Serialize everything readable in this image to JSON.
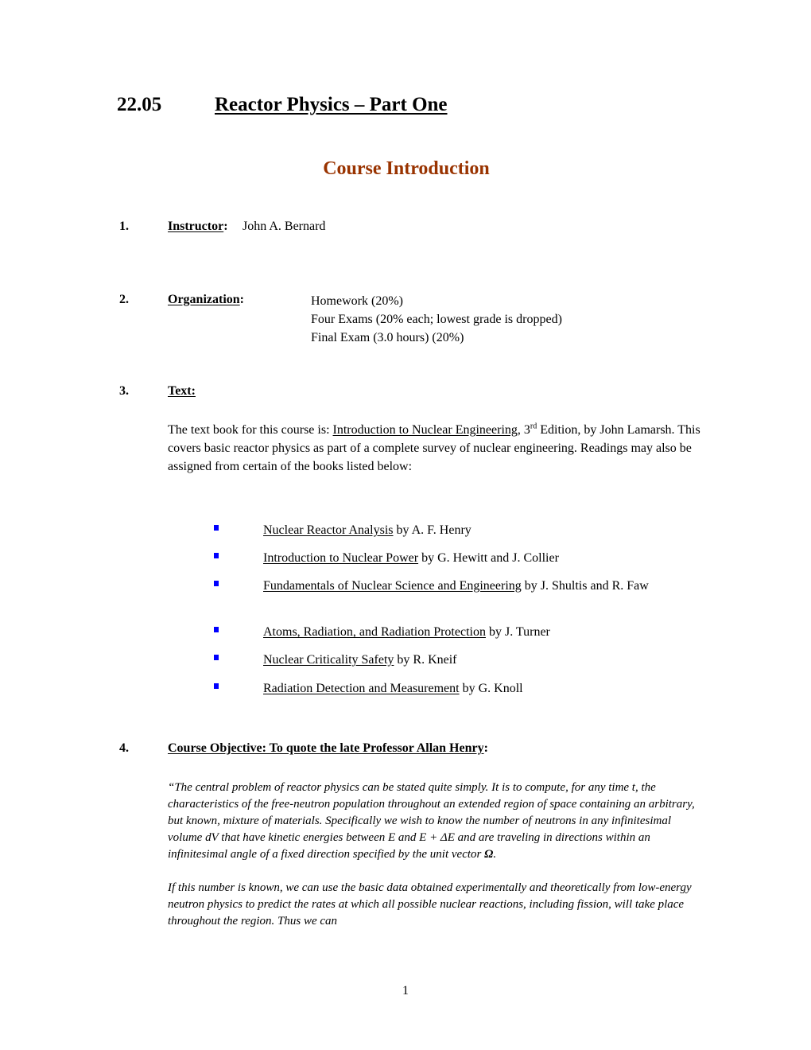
{
  "header": {
    "course_number": "22.05",
    "course_title": "Reactor Physics – Part One",
    "subtitle": "Course Introduction"
  },
  "colors": {
    "subtitle": "#993300",
    "bullet": "#0000ff"
  },
  "sections": {
    "instructor": {
      "number": "1.",
      "label": "Instructor",
      "colon": ":",
      "value": "John A. Bernard"
    },
    "organization": {
      "number": "2.",
      "label": "Organization",
      "colon": ":",
      "items": [
        "Homework  (20%)",
        "Four Exams (20% each; lowest grade is dropped)",
        "Final  Exam (3.0 hours)  (20%)"
      ]
    },
    "text": {
      "number": "3.",
      "label": "Text:",
      "intro_before": "The text book for this course is:  ",
      "textbook_title": "Introduction to Nuclear Engineering",
      "edition_num": ", 3",
      "edition_sup": "rd",
      "intro_after": " Edition, by John Lamarsh.  This covers basic reactor physics as part of a complete survey of nuclear engineering.  Readings may also be assigned from certain of the books listed below:",
      "books": [
        {
          "title": "Nuclear Reactor Analysis",
          "author": " by A. F. Henry"
        },
        {
          "title": "Introduction to Nuclear Power",
          "author": " by G. Hewitt and J. Collier"
        },
        {
          "title": "Fundamentals of Nuclear Science and Engineering",
          "author": " by J. Shultis and R. Faw"
        },
        {
          "title": "Atoms, Radiation, and Radiation Protection",
          "author": " by J. Turner"
        },
        {
          "title": "Nuclear Criticality Safety",
          "author": " by R. Kneif"
        },
        {
          "title": "Radiation Detection and Measurement",
          "author": " by G. Knoll"
        }
      ]
    },
    "objective": {
      "number": "4.",
      "label": "Course Objective:  To quote the late Professor Allan Henry",
      "colon": ":",
      "quote_p1": " “The central problem of reactor physics can be stated quite simply.  It is to compute, for any time t, the characteristics of the free-neutron population throughout an extended region of space containing an arbitrary, but known, mixture of materials.  Specifically we wish to know the number of neutrons in any infinitesimal volume dV that have kinetic energies between E and E + ΔE and are traveling in directions within an infinitesimal angle of a fixed direction specified by the unit vector ",
      "quote_p1_vector": "Ω",
      "quote_p1_end": ".",
      "quote_p2": "If this number is known, we can use the basic data obtained experimentally and theoretically from low-energy neutron physics to predict the rates at which all possible nuclear reactions, including fission, will take place throughout the region.  Thus we can"
    }
  },
  "footer": {
    "page_number": "1"
  }
}
